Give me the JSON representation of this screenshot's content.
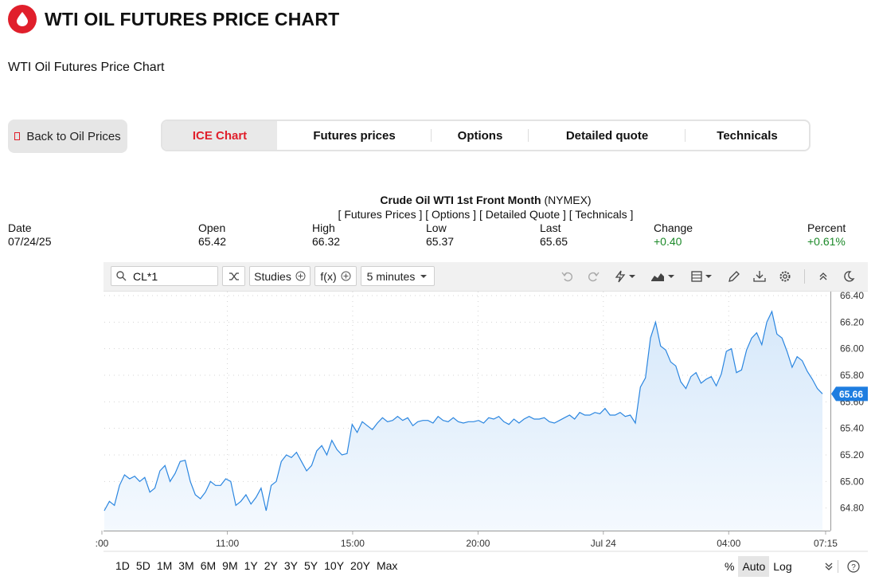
{
  "header": {
    "title": "WTI OIL FUTURES PRICE CHART",
    "subtitle": "WTI Oil Futures Price Chart",
    "logo_icon": "oil-drop-icon",
    "brand_color": "#e01f2b"
  },
  "back_button": {
    "label": "Back to Oil Prices"
  },
  "tabs": [
    {
      "label": "ICE Chart",
      "active": true
    },
    {
      "label": "Futures prices",
      "active": false
    },
    {
      "label": "Options",
      "active": false
    },
    {
      "label": "Detailed quote",
      "active": false
    },
    {
      "label": "Technicals",
      "active": false
    }
  ],
  "quote": {
    "name": "Crude Oil WTI 1st Front Month",
    "exchange": "(NYMEX)",
    "links": "[ Futures Prices ] [ Options ] [ Detailed Quote ] [ Technicals ]",
    "date_label": "Date",
    "date": "07/24/25",
    "open_label": "Open",
    "open": "65.42",
    "high_label": "High",
    "high": "66.32",
    "low_label": "Low",
    "low": "65.37",
    "last_label": "Last",
    "last": "65.65",
    "change_label": "Change",
    "change": "+0.40",
    "percent_label": "Percent",
    "percent": "+0.61%"
  },
  "toolbar": {
    "symbol": "CL*1",
    "studies_label": "Studies",
    "fx_label": "f(x)",
    "interval_label": "5 minutes",
    "icons": [
      "search-icon",
      "compare-icon",
      "plus-circle-icon",
      "chevron-down-icon",
      "undo-icon",
      "redo-icon",
      "lightning-icon",
      "chart-type-icon",
      "layout-icon",
      "pencil-icon",
      "download-icon",
      "gear-icon",
      "collapse-icon",
      "dark-mode-icon"
    ]
  },
  "chart_data": {
    "type": "area",
    "current_price_label": "65.66",
    "x_ticks": [
      ":00",
      "11:00",
      "15:00",
      "20:00",
      "Jul 24",
      "04:00",
      "07:15"
    ],
    "y_ticks": [
      "64.80",
      "65.00",
      "65.20",
      "65.40",
      "65.60",
      "65.80",
      "66.00",
      "66.20",
      "66.40"
    ],
    "ylim": [
      64.63,
      66.43
    ],
    "grid": true,
    "line_color": "#2b86e0",
    "fill_color": "#d6e8fa",
    "series": [
      {
        "values": [
          64.78,
          64.85,
          64.82,
          64.97,
          65.05,
          65.02,
          65.04,
          65.0,
          65.03,
          64.92,
          64.95,
          65.08,
          65.12,
          65.0,
          65.06,
          65.15,
          65.16,
          65.0,
          64.9,
          64.87,
          64.92,
          65.0,
          64.97,
          64.97,
          65.02,
          65.0,
          64.82,
          64.85,
          64.9,
          64.83,
          64.88,
          64.95,
          64.78,
          64.97,
          65.0,
          65.15,
          65.2,
          65.18,
          65.22,
          65.15,
          65.08,
          65.12,
          65.23,
          65.27,
          65.2,
          65.31,
          65.24,
          65.2,
          65.21,
          65.43,
          65.37,
          65.45,
          65.42,
          65.39,
          65.44,
          65.48,
          65.45,
          65.46,
          65.49,
          65.46,
          65.48,
          65.42,
          65.45,
          65.46,
          65.46,
          65.44,
          65.49,
          65.46,
          65.45,
          65.48,
          65.45,
          65.44,
          65.45,
          65.45,
          65.46,
          65.44,
          65.48,
          65.47,
          65.49,
          65.45,
          65.43,
          65.47,
          65.44,
          65.47,
          65.49,
          65.47,
          65.47,
          65.48,
          65.45,
          65.44,
          65.46,
          65.48,
          65.5,
          65.47,
          65.52,
          65.5,
          65.5,
          65.52,
          65.51,
          65.55,
          65.5,
          65.5,
          65.52,
          65.49,
          65.5,
          65.44,
          65.71,
          65.78,
          66.08,
          66.2,
          66.02,
          65.99,
          65.9,
          65.87,
          65.75,
          65.7,
          65.79,
          65.82,
          65.74,
          65.77,
          65.79,
          65.72,
          65.81,
          65.98,
          66.0,
          65.82,
          65.84,
          65.99,
          66.08,
          66.12,
          66.03,
          66.2,
          66.28,
          66.11,
          66.08,
          65.98,
          65.86,
          65.94,
          65.91,
          65.83,
          65.77,
          65.7,
          65.66
        ]
      }
    ]
  },
  "ranges": [
    "1D",
    "5D",
    "1M",
    "3M",
    "6M",
    "9M",
    "1Y",
    "2Y",
    "3Y",
    "5Y",
    "10Y",
    "20Y",
    "Max"
  ],
  "scale_options": [
    {
      "label": "%",
      "selected": false
    },
    {
      "label": "Auto",
      "selected": true
    },
    {
      "label": "Log",
      "selected": false
    }
  ],
  "footer_icons": [
    "chevrons-down-icon",
    "help-icon"
  ]
}
